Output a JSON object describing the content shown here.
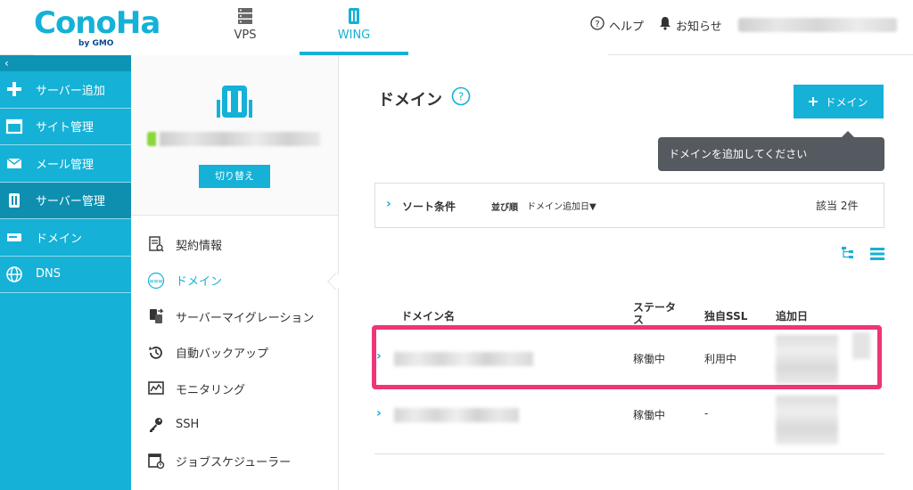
{
  "header": {
    "logo_main": "ConoHa",
    "logo_sub": "by GMO",
    "tabs": [
      {
        "label": "VPS"
      },
      {
        "label": "WING"
      }
    ],
    "help_label": "ヘルプ",
    "notice_label": "お知らせ"
  },
  "sidebar": {
    "collapse_label": "‹",
    "items": [
      {
        "label": "サーバー追加",
        "icon": "plus-icon"
      },
      {
        "label": "サイト管理",
        "icon": "window-icon"
      },
      {
        "label": "メール管理",
        "icon": "mail-icon"
      },
      {
        "label": "サーバー管理",
        "icon": "server-icon"
      },
      {
        "label": "ドメイン",
        "icon": "domain-icon"
      },
      {
        "label": "DNS",
        "icon": "globe-icon"
      }
    ]
  },
  "server_panel": {
    "switch_label": "切り替え",
    "menu": [
      {
        "label": "契約情報",
        "icon": "contract-icon"
      },
      {
        "label": "ドメイン",
        "icon": "www-icon"
      },
      {
        "label": "サーバーマイグレーション",
        "icon": "migration-icon"
      },
      {
        "label": "自動バックアップ",
        "icon": "backup-icon"
      },
      {
        "label": "モニタリング",
        "icon": "monitor-icon"
      },
      {
        "label": "SSH",
        "icon": "key-icon"
      },
      {
        "label": "ジョブスケジューラー",
        "icon": "scheduler-icon"
      }
    ]
  },
  "main": {
    "title": "ドメイン",
    "add_button_label": "ドメイン",
    "tooltip": "ドメインを追加してください",
    "sort": {
      "label": "ソート条件",
      "order_label": "並び順",
      "order_value": "ドメイン追加日▼",
      "count": "該当 2件"
    },
    "table": {
      "headers": [
        "ドメイン名",
        "ステータス",
        "独自SSL",
        "追加日"
      ],
      "rows": [
        {
          "status": "稼働中",
          "ssl": "利用中"
        },
        {
          "status": "稼働中",
          "ssl": "-"
        }
      ]
    }
  },
  "colors": {
    "brand": "#15b1d7",
    "highlight": "#ee3577",
    "tooltip_bg": "#555a60"
  }
}
